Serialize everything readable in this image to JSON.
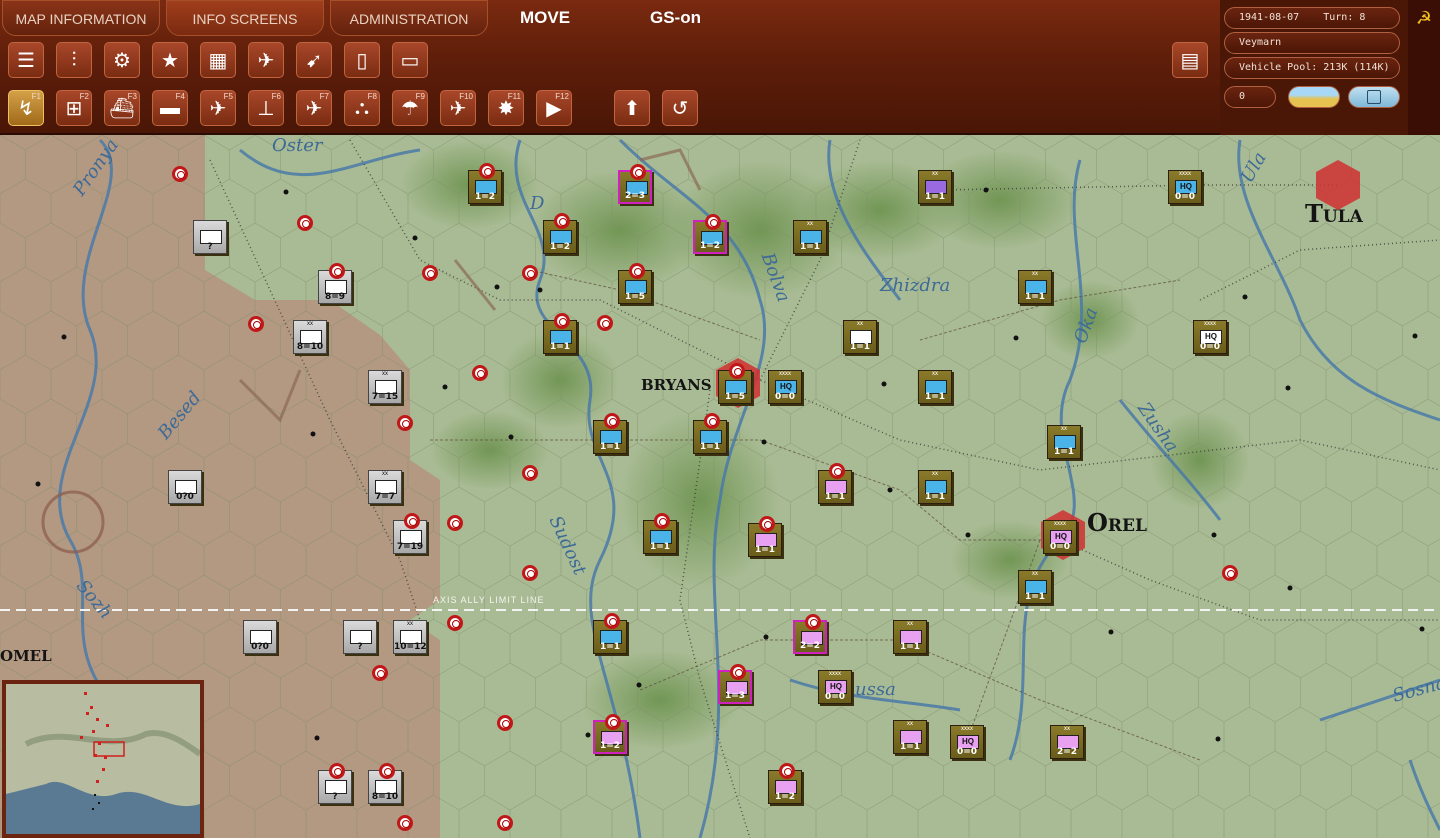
{
  "tabs": {
    "map_information": "MAP INFORMATION",
    "info_screens": "INFO SCREENS",
    "administration": "ADMINISTRATION"
  },
  "mode_move": "MOVE",
  "mode_gs": "GS-on",
  "info_panel": {
    "date": "1941-08-07",
    "turn_label": "Turn: 8",
    "commander": "Veymarn",
    "vehicle_pool": "Vehicle Pool: 213K (114K)",
    "counter_value": "0"
  },
  "function_keys": [
    "F1",
    "F2",
    "F3",
    "F4",
    "F5",
    "F6",
    "F7",
    "F8",
    "F9",
    "F10",
    "F11",
    "F12"
  ],
  "map": {
    "cities": {
      "bryansk": "BRYANS",
      "orel": "Orel",
      "tula": "Tula",
      "gomel": "OMEL"
    },
    "rivers": {
      "oster": "Oster",
      "pronya": "Pronya",
      "besed": "Besed",
      "bolva": "Bolva",
      "zhizdra": "Zhizdra",
      "oka": "Oka",
      "zusha": "Zusha",
      "ula": "Ula",
      "sudost": "Sudost",
      "sozh": "Sozh",
      "sosna": "Sosna",
      "russa": "ussa",
      "desna": "D"
    },
    "limit_line": "AXIS ALLY LIMIT LINE"
  },
  "colors": {
    "soviet_unit": "#8a7a2a",
    "axis_unit": "#c8c8c8",
    "selected_border": "#d020c0",
    "infantry_fill": "#4ab4e8",
    "zoc_ring": "#c01818"
  },
  "counters": [
    {
      "str": "1=2",
      "fill": "#4ab4e8"
    },
    {
      "str": "2=3",
      "fill": "#4ab4e8"
    },
    {
      "str": "1=2",
      "fill": "#4ab4e8"
    },
    {
      "str": "1=2",
      "fill": "#4ab4e8"
    },
    {
      "str": "1=1",
      "fill": "#4ab4e8"
    },
    {
      "str": "1=1",
      "fill": "#9a6ae0"
    },
    {
      "str": "0=0",
      "fill": "#4ab4e8"
    },
    {
      "str": "1=5",
      "fill": "#4ab4e8"
    },
    {
      "str": "1=1",
      "fill": "#4ab4e8"
    },
    {
      "str": "1=1",
      "fill": "#4ab4e8"
    },
    {
      "str": "1=1",
      "fill": "#ffffff"
    },
    {
      "str": "0=0",
      "fill": "#ffffff"
    },
    {
      "str": "1=5",
      "fill": "#4ab4e8"
    },
    {
      "str": "0=0",
      "fill": "#4ab4e8"
    },
    {
      "str": "1=1",
      "fill": "#4ab4e8"
    },
    {
      "str": "1=1",
      "fill": "#4ab4e8"
    },
    {
      "str": "1=1",
      "fill": "#4ab4e8"
    },
    {
      "str": "1=1",
      "fill": "#4ab4e8"
    },
    {
      "str": "1=1",
      "fill": "#e8a0f0"
    },
    {
      "str": "1=1",
      "fill": "#4ab4e8"
    },
    {
      "str": "1=1",
      "fill": "#4ab4e8"
    },
    {
      "str": "1=1",
      "fill": "#e8a0f0"
    },
    {
      "str": "0=0",
      "fill": "#e8a0f0"
    },
    {
      "str": "1=1",
      "fill": "#4ab4e8"
    },
    {
      "str": "1=1",
      "fill": "#4ab4e8"
    },
    {
      "str": "2=2",
      "fill": "#e8a0f0"
    },
    {
      "str": "1=1",
      "fill": "#e8a0f0"
    },
    {
      "str": "1=3",
      "fill": "#e8a0f0"
    },
    {
      "str": "0=0",
      "fill": "#e8a0f0"
    },
    {
      "str": "1=2",
      "fill": "#e8a0f0"
    },
    {
      "str": "1=1",
      "fill": "#e8a0f0"
    },
    {
      "str": "0=0",
      "fill": "#e8a0f0"
    },
    {
      "str": "2=2",
      "fill": "#e8a0f0"
    },
    {
      "str": "1=2",
      "fill": "#e8a0f0"
    }
  ],
  "axis_counters": [
    {
      "str": "?"
    },
    {
      "str": "8=9"
    },
    {
      "str": "8=10"
    },
    {
      "str": "7=15"
    },
    {
      "str": "0?0"
    },
    {
      "str": "7=7"
    },
    {
      "str": "7=19"
    },
    {
      "str": "0?0"
    },
    {
      "str": "?"
    },
    {
      "str": "10=12"
    },
    {
      "str": "?"
    },
    {
      "str": "8=10"
    }
  ]
}
